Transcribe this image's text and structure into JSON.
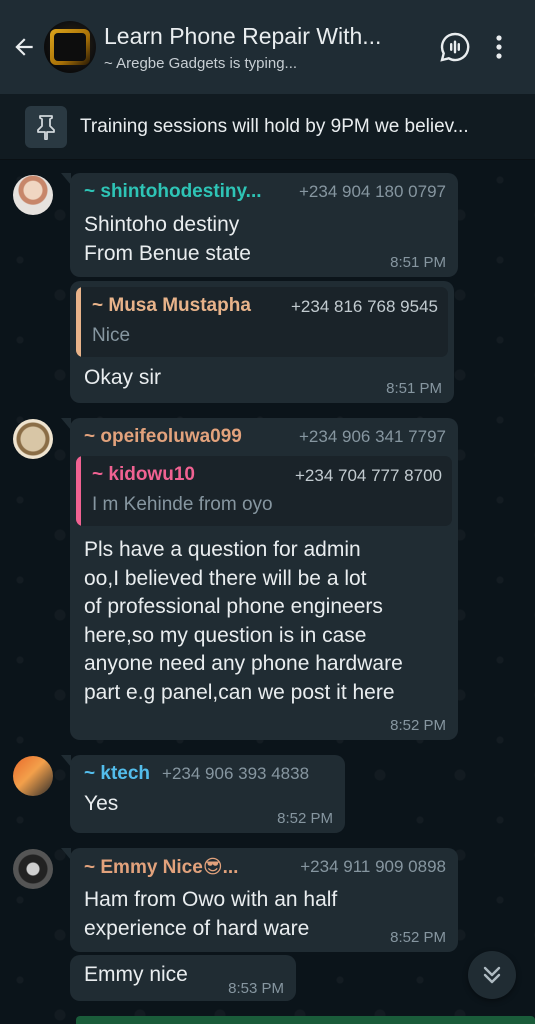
{
  "header": {
    "title": "Learn Phone Repair With...",
    "subtitle": "~ Aregbe Gadgets is typing..."
  },
  "pinned": {
    "text": "Training sessions will hold by 9PM we believ..."
  },
  "messages": [
    {
      "sender": "~ shintohodestiny...",
      "sender_color": "#2ec4b6",
      "phone": "+234 904 180 0797",
      "text": "Shintoho destiny\nFrom Benue state",
      "time": "8:51 PM"
    },
    {
      "quote": {
        "name": "~ Musa Mustapha",
        "name_color": "#e8b38a",
        "bar_color": "#e8b38a",
        "phone": "+234 816 768 9545",
        "text": "Nice"
      },
      "text": "Okay sir",
      "time": "8:51 PM"
    },
    {
      "sender": "~ opeifeoluwa099",
      "sender_color": "#e2a27c",
      "phone": "+234 906 341 7797",
      "quote": {
        "name": "~ kidowu10",
        "name_color": "#f06292",
        "bar_color": "#f06292",
        "phone": "+234 704 777 8700",
        "text": "I m Kehinde from oyo"
      },
      "text": "Pls have a question for admin\noo,I believed there will be a lot\nof professional phone engineers\nhere,so my question is  in case\nanyone need any phone hardware\npart e.g panel,can we post it here",
      "time": "8:52 PM"
    },
    {
      "sender": "~ ktech",
      "sender_color": "#53bdeb",
      "phone": "+234 906 393 4838",
      "text": "Yes",
      "time": "8:52 PM"
    },
    {
      "sender": "~ Emmy Nice😎...",
      "sender_color": "#e2a27c",
      "phone": "+234 911 909 0898",
      "text": "Ham from Owo with   an half\nexperience of hard  ware",
      "time": "8:52 PM"
    },
    {
      "text": "Emmy nice",
      "time": "8:53 PM"
    }
  ],
  "colors": {
    "header_bg": "#1f2c34",
    "chat_bg": "#0b141a",
    "bubble_bg": "#202c33",
    "meta_text": "#8696a0"
  }
}
